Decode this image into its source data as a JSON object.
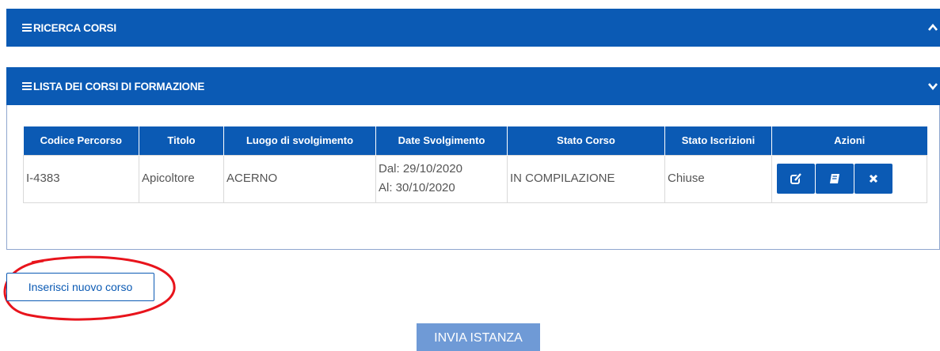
{
  "search_panel": {
    "title": "RICERCA CORSI",
    "collapsed_icon": "chevron-up-icon"
  },
  "list_panel": {
    "title": "LISTA DEI CORSI DI FORMAZIONE",
    "toggle_icon": "chevron-down-icon",
    "table": {
      "headers": [
        "Codice Percorso",
        "Titolo",
        "Luogo di svolgimento",
        "Date Svolgimento",
        "Stato Corso",
        "Stato Iscrizioni",
        "Azioni"
      ],
      "rows": [
        {
          "codice": "I-4383",
          "titolo": "Apicoltore",
          "luogo": "ACERNO",
          "date_dal": "Dal: 29/10/2020",
          "date_al": "Al: 30/10/2020",
          "stato_corso": "IN COMPILAZIONE",
          "stato_iscrizioni": "Chiuse",
          "actions": [
            "edit-icon",
            "book-icon",
            "close-icon"
          ]
        }
      ]
    }
  },
  "new_course_button": "Inserisci nuovo corso",
  "send_button": "INVIA ISTANZA",
  "colors": {
    "primary": "#0b5ab4",
    "send_disabled": "#6f9ad6",
    "annotation": "#e8141c"
  }
}
